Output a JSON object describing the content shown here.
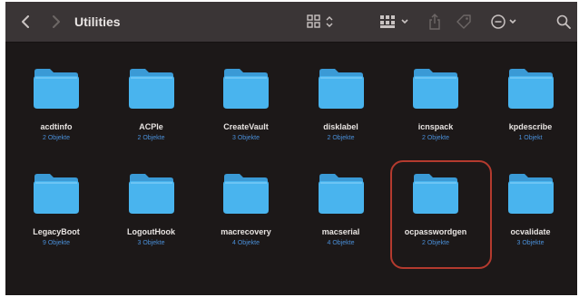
{
  "window": {
    "title": "Utilities"
  },
  "toolbar": {
    "back_icon": "chevron-left-icon",
    "forward_icon": "chevron-right-icon",
    "view_icon": "icon-grid-view-icon",
    "group_icon": "group-by-icon",
    "share_icon": "share-icon",
    "tag_icon": "tag-icon",
    "action_icon": "action-menu-icon",
    "search_icon": "search-icon"
  },
  "colors": {
    "background": "#1c1818",
    "toolbar": "#3a3536",
    "folder": "#49b4ee",
    "count_text": "#4a8fd8",
    "highlight_ring": "#b43a2e"
  },
  "items": [
    {
      "name": "acdtinfo",
      "count": "2 Objekte"
    },
    {
      "name": "ACPIe",
      "count": "2 Objekte"
    },
    {
      "name": "CreateVault",
      "count": "3 Objekte"
    },
    {
      "name": "disklabel",
      "count": "2 Objekte"
    },
    {
      "name": "icnspack",
      "count": "2 Objekte"
    },
    {
      "name": "kpdescribe",
      "count": "1 Objekt"
    },
    {
      "name": "LegacyBoot",
      "count": "9 Objekte"
    },
    {
      "name": "LogoutHook",
      "count": "3 Objekte"
    },
    {
      "name": "macrecovery",
      "count": "4 Objekte"
    },
    {
      "name": "macserial",
      "count": "4 Objekte"
    },
    {
      "name": "ocpasswordgen",
      "count": "2 Objekte",
      "highlighted": true
    },
    {
      "name": "ocvalidate",
      "count": "3 Objekte"
    }
  ]
}
